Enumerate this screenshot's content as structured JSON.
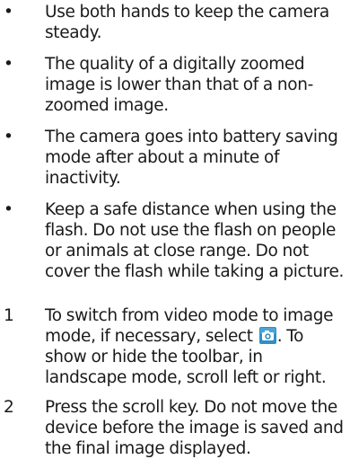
{
  "bullet_glyph": "•",
  "bullets": [
    "Use both hands to keep the camera steady.",
    "The quality of a digitally zoomed image is lower than that of a non-zoomed image.",
    "The camera goes into battery saving mode after about a minute of inactivity.",
    "Keep a safe distance when using the flash. Do not use the flash on people or animals at close range. Do not cover the flash while taking a picture."
  ],
  "steps": [
    {
      "number": "1",
      "text_before_icon": "To switch from video mode to image mode, if necessary, select",
      "icon": "camera-icon",
      "text_after_icon": ". To show or hide the toolbar, in landscape mode, scroll left or right."
    },
    {
      "number": "2",
      "text": "Press the scroll key. Do not move the device before the image is saved and the final image displayed."
    }
  ],
  "colors": {
    "text": "#1a1a1a",
    "icon_background": "#2f8fc6",
    "icon_glyph": "#ffffff"
  }
}
